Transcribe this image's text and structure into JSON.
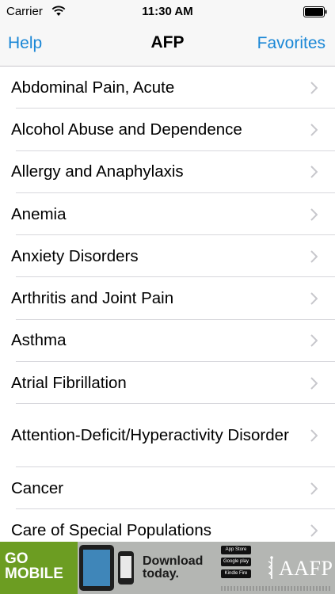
{
  "status_bar": {
    "carrier": "Carrier",
    "time": "11:30 AM"
  },
  "nav": {
    "left": "Help",
    "title": "AFP",
    "right": "Favorites"
  },
  "list": {
    "items": [
      {
        "label": "Abdominal Pain, Acute"
      },
      {
        "label": "Alcohol Abuse and Dependence"
      },
      {
        "label": "Allergy and Anaphylaxis"
      },
      {
        "label": "Anemia"
      },
      {
        "label": "Anxiety Disorders"
      },
      {
        "label": "Arthritis and Joint Pain"
      },
      {
        "label": "Asthma"
      },
      {
        "label": "Atrial Fibrillation"
      },
      {
        "label": "Attention-Deficit/Hyperactivity Disorder"
      },
      {
        "label": "Cancer"
      },
      {
        "label": "Care of Special Populations"
      }
    ]
  },
  "ad": {
    "line1": "GO",
    "line2": "MOBILE",
    "cta1": "Download",
    "cta2": "today.",
    "store1": "App Store",
    "store2": "Google play",
    "store3": "Kindle Fire",
    "brand": "AAFP"
  },
  "colors": {
    "accent": "#1a87d6",
    "ad_green": "#6c9d22"
  }
}
